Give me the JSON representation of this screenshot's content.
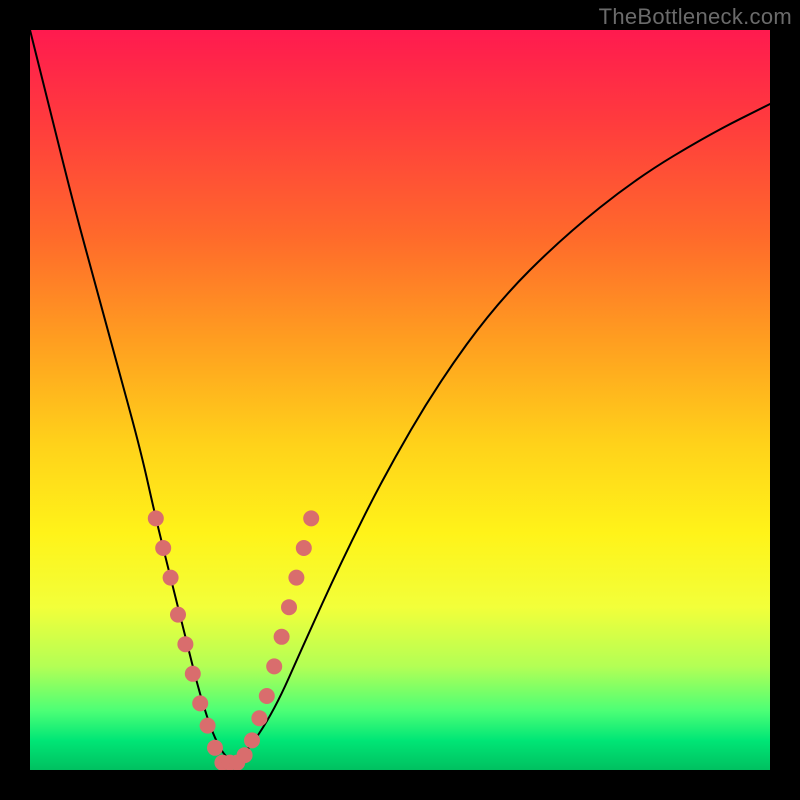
{
  "watermark": "TheBottleneck.com",
  "chart_data": {
    "type": "line",
    "title": "",
    "xlabel": "",
    "ylabel": "",
    "xlim": [
      0,
      100
    ],
    "ylim": [
      0,
      100
    ],
    "grid": false,
    "series": [
      {
        "name": "bottleneck-curve",
        "x": [
          0,
          3,
          6,
          9,
          12,
          15,
          17,
          19,
          21,
          23,
          25,
          27,
          29,
          33,
          37,
          42,
          48,
          55,
          63,
          72,
          82,
          92,
          100
        ],
        "y": [
          100,
          88,
          76,
          65,
          54,
          43,
          34,
          26,
          18,
          10,
          4,
          1,
          2,
          8,
          17,
          28,
          40,
          52,
          63,
          72,
          80,
          86,
          90
        ],
        "stroke": "#000000",
        "stroke_width": 2
      }
    ],
    "markers": {
      "name": "highlight-dots",
      "color": "#d96d6d",
      "radius": 8,
      "points": [
        {
          "x": 17,
          "y": 34
        },
        {
          "x": 18,
          "y": 30
        },
        {
          "x": 19,
          "y": 26
        },
        {
          "x": 20,
          "y": 21
        },
        {
          "x": 21,
          "y": 17
        },
        {
          "x": 22,
          "y": 13
        },
        {
          "x": 23,
          "y": 9
        },
        {
          "x": 24,
          "y": 6
        },
        {
          "x": 25,
          "y": 3
        },
        {
          "x": 26,
          "y": 1
        },
        {
          "x": 27,
          "y": 1
        },
        {
          "x": 28,
          "y": 1
        },
        {
          "x": 29,
          "y": 2
        },
        {
          "x": 30,
          "y": 4
        },
        {
          "x": 31,
          "y": 7
        },
        {
          "x": 32,
          "y": 10
        },
        {
          "x": 33,
          "y": 14
        },
        {
          "x": 34,
          "y": 18
        },
        {
          "x": 35,
          "y": 22
        },
        {
          "x": 36,
          "y": 26
        },
        {
          "x": 37,
          "y": 30
        },
        {
          "x": 38,
          "y": 34
        }
      ]
    }
  }
}
